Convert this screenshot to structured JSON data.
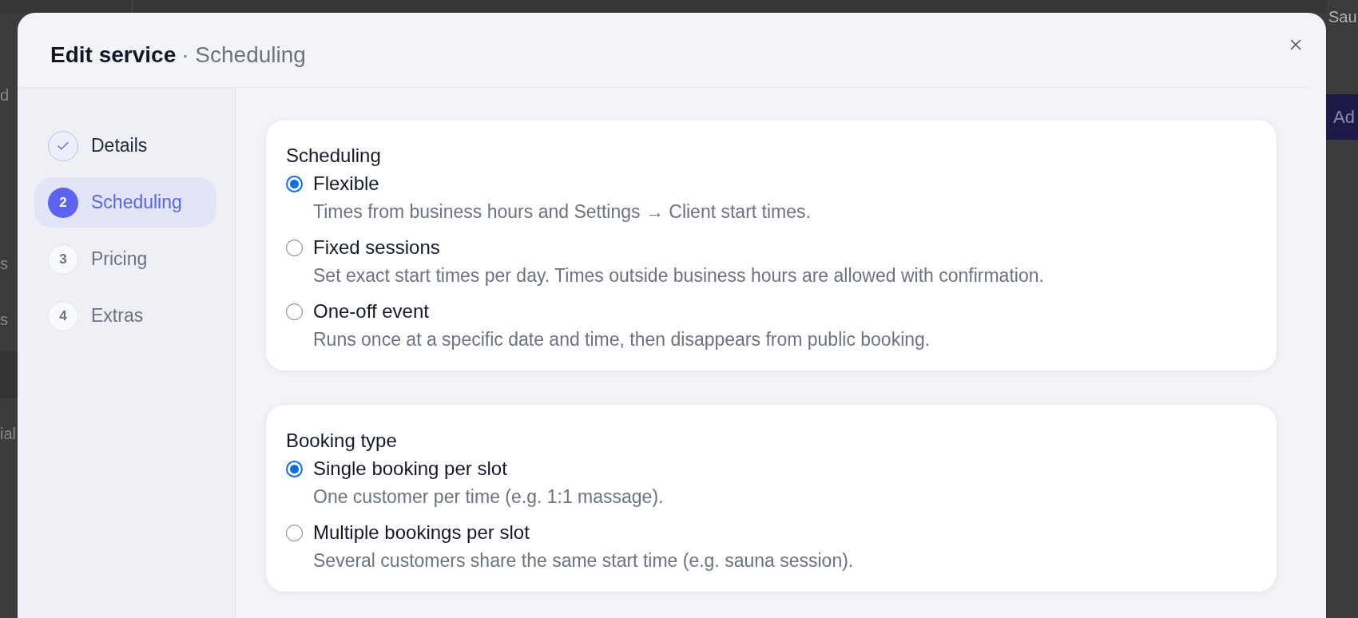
{
  "background": {
    "left_fragments": [
      "d",
      "s",
      "s",
      "ial"
    ],
    "top_right_fragment": "Sau",
    "button_fragment": "Ad"
  },
  "dialog": {
    "title": "Edit service",
    "subtitle": "· Scheduling"
  },
  "steps": [
    {
      "label": "Details",
      "completed": true,
      "selected": false
    },
    {
      "number": "2",
      "label": "Scheduling",
      "completed": false,
      "selected": true
    },
    {
      "number": "3",
      "label": "Pricing",
      "completed": false,
      "selected": false
    },
    {
      "number": "4",
      "label": "Extras",
      "completed": false,
      "selected": false
    }
  ],
  "sections": [
    {
      "title": "Scheduling",
      "options": [
        {
          "label": "Flexible",
          "description": "Times from business hours and Settings → Client start times.",
          "selected": true
        },
        {
          "label": "Fixed sessions",
          "description": "Set exact start times per day. Times outside business hours are allowed with confirmation.",
          "selected": false
        },
        {
          "label": "One-off event",
          "description": "Runs once at a specific date and time, then disappears from public booking.",
          "selected": false
        }
      ]
    },
    {
      "title": "Booking type",
      "options": [
        {
          "label": "Single booking per slot",
          "description": "One customer per time (e.g. 1:1 massage).",
          "selected": true
        },
        {
          "label": "Multiple bookings per slot",
          "description": "Several customers share the same start time (e.g. sauna session).",
          "selected": false
        }
      ]
    }
  ]
}
